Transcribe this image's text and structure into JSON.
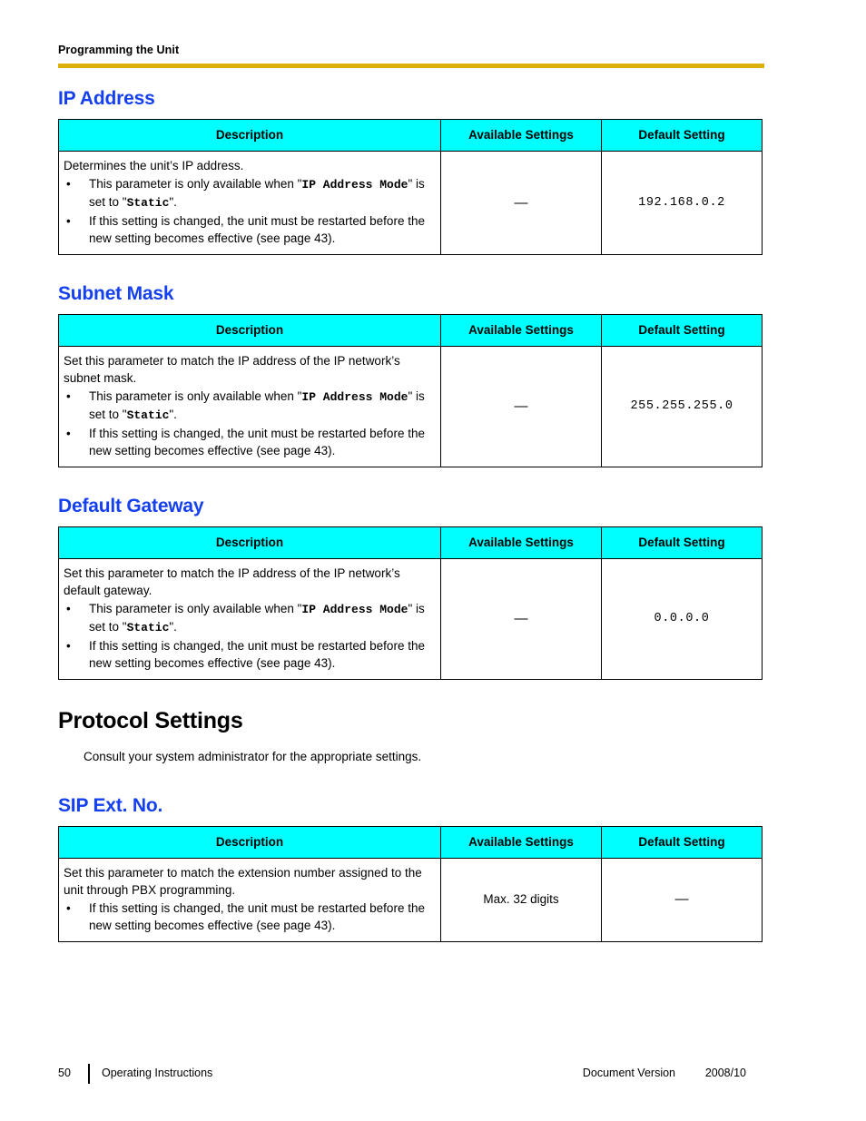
{
  "header": {
    "running_title": "Programming the Unit",
    "rule_color": "#dcb00a"
  },
  "colors": {
    "heading_blue": "#1540f0",
    "table_header_cyan": "#00ffff",
    "rule_gold": "#dcb00a"
  },
  "table_headers": {
    "description": "Description",
    "available_settings": "Available Settings",
    "default_setting": "Default Setting"
  },
  "sections": {
    "ip_address": {
      "heading": "IP Address",
      "lead": "Determines the unit’s IP address.",
      "bullets": [
        {
          "part1": "This parameter is only available when \"",
          "mono1": "IP Address Mode",
          "part2": "\" is set to \"",
          "mono2": "Static",
          "part3": "\"."
        },
        {
          "plain": "If this setting is changed, the unit must be restarted before the new setting becomes effective (see page 43)."
        }
      ],
      "available_settings": "—",
      "default_setting": "192.168.0.2"
    },
    "subnet_mask": {
      "heading": "Subnet Mask",
      "lead": "Set this parameter to match the IP address of the IP network’s subnet mask.",
      "bullets": [
        {
          "part1": "This parameter is only available when \"",
          "mono1": "IP Address Mode",
          "part2": "\" is set to \"",
          "mono2": "Static",
          "part3": "\"."
        },
        {
          "plain": "If this setting is changed, the unit must be restarted before the new setting becomes effective (see page 43)."
        }
      ],
      "available_settings": "—",
      "default_setting": "255.255.255.0"
    },
    "default_gateway": {
      "heading": "Default Gateway",
      "lead": "Set this parameter to match the IP address of the IP network’s default gateway.",
      "bullets": [
        {
          "part1": "This parameter is only available when \"",
          "mono1": "IP Address Mode",
          "part2": "\" is set to \"",
          "mono2": "Static",
          "part3": "\"."
        },
        {
          "plain": "If this setting is changed, the unit must be restarted before the new setting becomes effective (see page 43)."
        }
      ],
      "available_settings": "—",
      "default_setting": "0.0.0.0"
    },
    "protocol_settings": {
      "heading": "Protocol Settings",
      "note": "Consult your system administrator for the appropriate settings."
    },
    "sip_ext_no": {
      "heading": "SIP Ext. No.",
      "lead": "Set this parameter to match the extension number assigned to the unit through PBX programming.",
      "bullets": [
        {
          "plain": "If this setting is changed, the unit must be restarted before the new setting becomes effective (see page 43)."
        }
      ],
      "available_settings": "Max. 32 digits",
      "default_setting": "—"
    }
  },
  "bullet_glyph": "•",
  "footer": {
    "page_number": "50",
    "doc_title": "Operating Instructions",
    "version_label": "Document Version",
    "version_value": "2008/10"
  }
}
